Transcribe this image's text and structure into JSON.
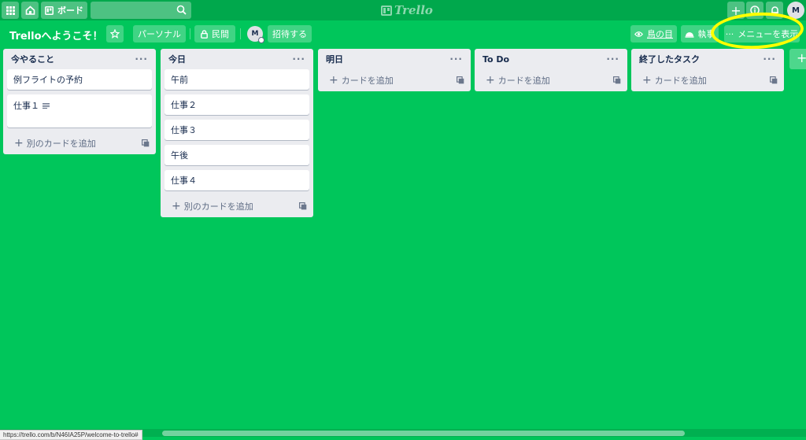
{
  "header": {
    "boards_label": "ボード",
    "logo_text": "Trello",
    "avatar_initial": "M"
  },
  "board": {
    "title": "Trelloへようこそ！",
    "team_label": "パーソナル",
    "visibility_label": "民間",
    "member_initial": "M",
    "invite_label": "招待する",
    "view_label": "鳥の目",
    "butler_label": "執事",
    "menu_label": "メニューを表示",
    "add_list_icon": "plus"
  },
  "lists": [
    {
      "title": "今やること",
      "cards": [
        {
          "title": "例フライトの予約",
          "has_description": false
        },
        {
          "title": "仕事１",
          "has_description": true
        }
      ],
      "add_label": "別のカードを追加"
    },
    {
      "title": "今日",
      "cards": [
        {
          "title": "午前"
        },
        {
          "title": "仕事２"
        },
        {
          "title": "仕事３"
        },
        {
          "title": "午後"
        },
        {
          "title": "仕事４"
        }
      ],
      "add_label": "別のカードを追加"
    },
    {
      "title": "明日",
      "cards": [],
      "add_label": "カードを追加"
    },
    {
      "title": "To Do",
      "cards": [],
      "add_label": "カードを追加"
    },
    {
      "title": "終了したタスク",
      "cards": [],
      "add_label": "カードを追加"
    }
  ],
  "status_url": "https://trello.com/b/N46IA25P/welcome-to-trello#",
  "colors": {
    "board_background": "#00c65b",
    "header_background": "#00a84c",
    "annotation": "#ffff00"
  }
}
